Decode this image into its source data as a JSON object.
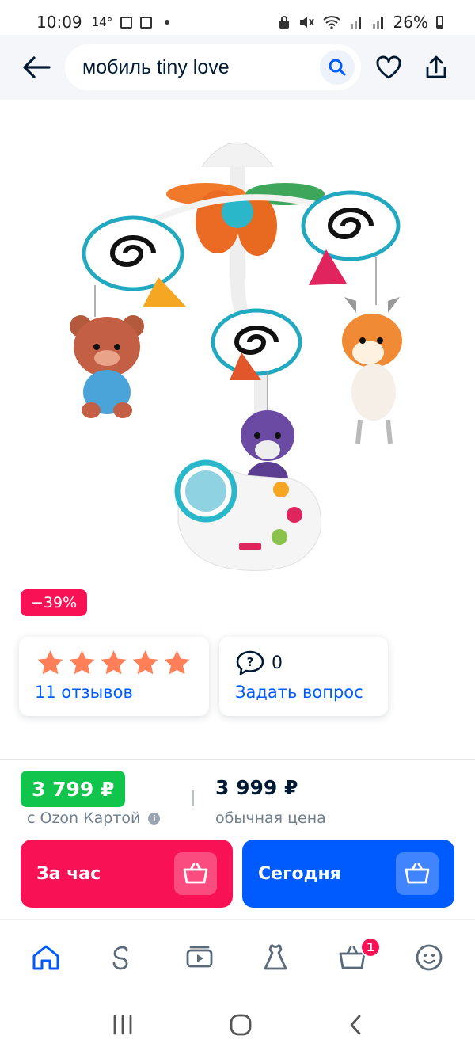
{
  "status_bar": {
    "time": "10:09",
    "temperature": "14°",
    "battery": "26%"
  },
  "search": {
    "query": "мобиль tiny love"
  },
  "product": {
    "discount": "−39%",
    "reviews_label": "11 отзывов",
    "rating_stars": 5,
    "questions_count": "0",
    "questions_label": "Задать вопрос",
    "ozon_card_price": "3 799 ₽",
    "ozon_card_label": "с Ozon Картой",
    "regular_price": "3 999 ₽",
    "regular_label": "обычная цена"
  },
  "buy_buttons": {
    "hour_label": "За час",
    "today_label": "Сегодня"
  },
  "bottom_nav": {
    "cart_badge": "1"
  },
  "colors": {
    "brand_blue": "#005bff",
    "accent_pink": "#f91155",
    "green": "#10c44c",
    "star": "#ff7f59"
  }
}
